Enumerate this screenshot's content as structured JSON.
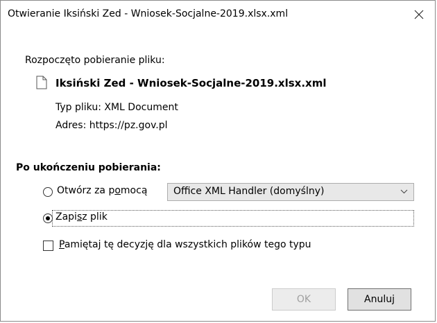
{
  "window": {
    "title": "Otwieranie Iksiński Zed - Wniosek-Socjalne-2019.xlsx.xml"
  },
  "download": {
    "intro": "Rozpoczęto pobieranie pliku:",
    "filename": "Iksiński Zed - Wniosek-Socjalne-2019.xlsx.xml",
    "type_label": "Typ pliku:",
    "type_value": "XML Document",
    "address_label": "Adres:",
    "address_value": "https://pz.gov.pl"
  },
  "after_download": {
    "heading": "Po ukończeniu pobierania:",
    "open_with_label_pre": "Otwórz za p",
    "open_with_label_u": "o",
    "open_with_label_post": "mocą",
    "open_with_selected": false,
    "handler_value": "Office XML Handler (domyślny)",
    "save_label_pre": "Zapi",
    "save_label_u": "s",
    "save_label_post": "z plik",
    "save_selected": true,
    "remember_label_pre": "",
    "remember_label_u": "P",
    "remember_label_post": "amiętaj tę decyzję dla wszystkich plików tego typu",
    "remember_checked": false
  },
  "buttons": {
    "ok": "OK",
    "cancel": "Anuluj"
  },
  "icons": {
    "close": "close-icon",
    "file": "file-icon",
    "chevron": "chevron-down-icon"
  }
}
